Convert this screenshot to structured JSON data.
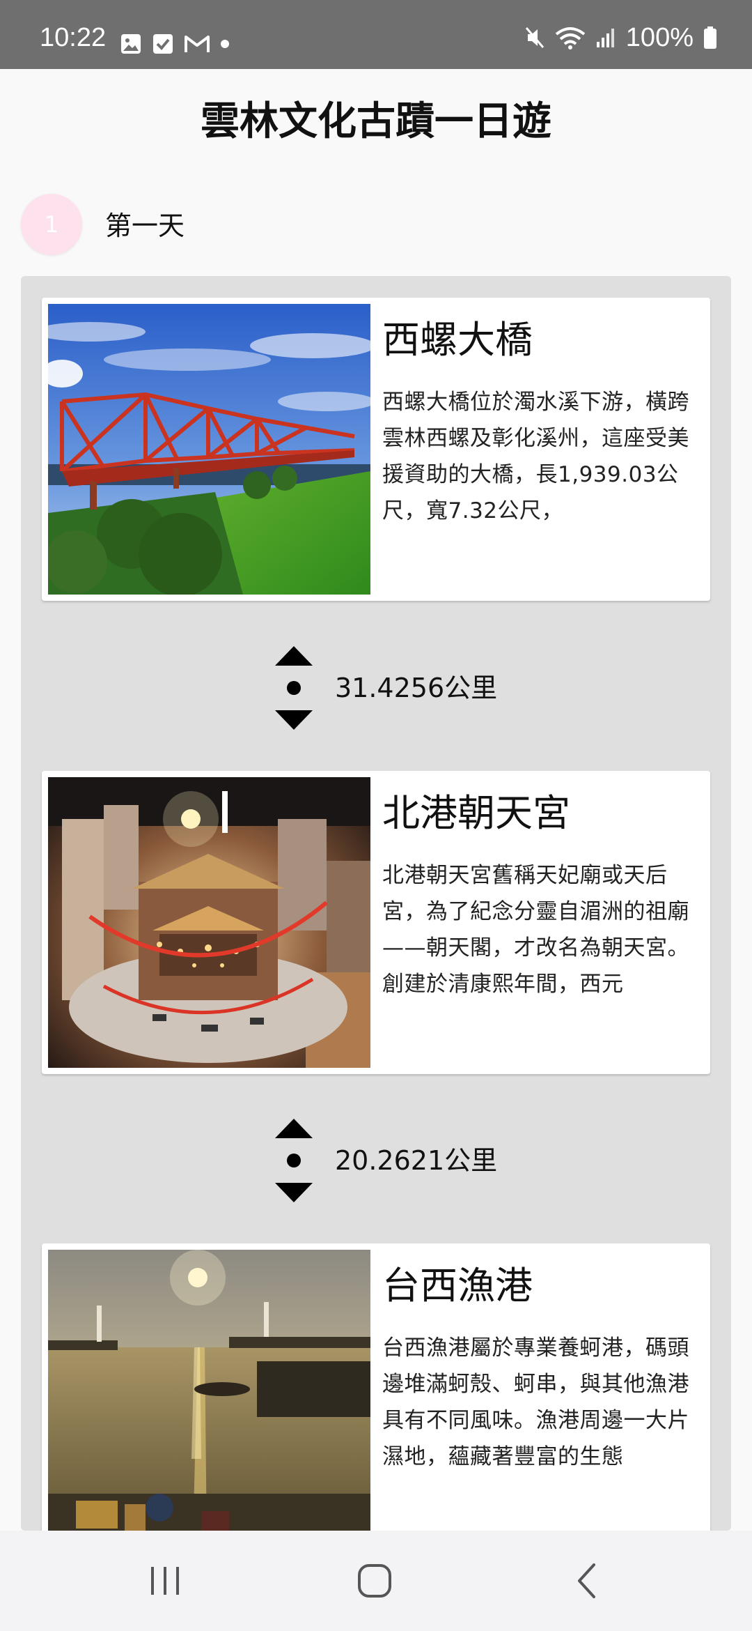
{
  "status_bar": {
    "time": "10:22",
    "battery": "100%",
    "left_icons": [
      "image-icon",
      "checkbox-icon",
      "gmail-icon",
      "dot-icon"
    ],
    "right_icons": [
      "mute-icon",
      "wifi-icon",
      "signal-icon",
      "battery-icon"
    ]
  },
  "header": {
    "title": "雲林文化古蹟一日遊"
  },
  "day": {
    "number": "1",
    "label": "第一天"
  },
  "places": [
    {
      "name": "西螺大橋",
      "description": "西螺大橋位於濁水溪下游，橫跨雲林西螺及彰化溪州，這座受美援資助的大橋，長1,939.03公尺，寬7.32公尺，"
    },
    {
      "name": "北港朝天宮",
      "description": "北港朝天宮舊稱天妃廟或天后宮，為了紀念分靈自湄洲的祖廟——朝天閣，才改名為朝天宮。創建於清康熙年間，西元"
    },
    {
      "name": "台西漁港",
      "description": "台西漁港屬於專業養蚵港，碼頭邊堆滿蚵殼、蚵串，與其他漁港具有不同風味。漁港周邊一大片濕地，蘊藏著豐富的生態"
    }
  ],
  "distances": [
    {
      "text": "31.4256公里"
    },
    {
      "text": "20.2621公里"
    }
  ],
  "nav": {
    "buttons": [
      "recent-apps-icon",
      "home-icon",
      "back-icon"
    ]
  },
  "colors": {
    "status_bar_bg": "#6f6f6f",
    "panel_bg": "#dfdfdf",
    "day_badge_bg": "#fde1ec",
    "nav_bar_bg": "#f3f3f5"
  }
}
